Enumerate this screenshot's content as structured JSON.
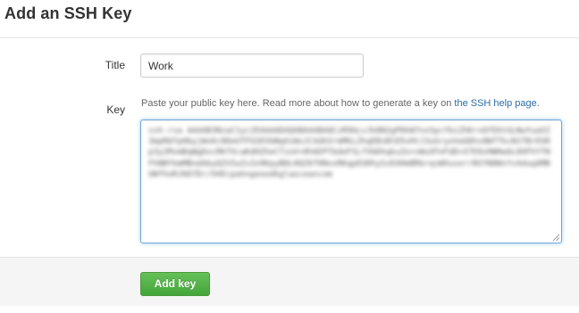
{
  "page": {
    "heading": "Add an SSH Key"
  },
  "form": {
    "title_label": "Title",
    "title_value": "Work",
    "key_label": "Key",
    "help_prefix": "Paste your public key here. Read more about how to generate a key on ",
    "help_link": "the SSH help page",
    "help_suffix": ".",
    "key_value": "ssh-rsa AAAAB3NzaC1yc2EAAAADAQABAAABAQCzR9bLvJk8N2gPDkW7nxSpcYbiZhKrvQfE6tGLNwYuaXZ3mpMdfpHbyjWsKc0DeUTFGSEVbNqOiWxJCXdkVrmMkLZhqEBsBtD5vHtJ3uGryoVaGDhs0WfTkcN1TBrEGRp3y2MvmBqWgDxcRKfXcaKdHZheCTzoV+8h6EPTbdeFSLfVbDhqkuZo+vWuXFeFdD+X7E0zHWHwbL8OFhYTNFhNBYkmMBndAbyQZVIwZvZo9KpyBDL0QZ6T0NxxRKqpEUDhySzEAHmBRbrqsWXuserrNSYN8WsYv4duqAMBUWfhoRJ6D7Dr/O4Ecpahngeoodkglaoceancom"
  },
  "actions": {
    "submit_label": "Add key"
  }
}
